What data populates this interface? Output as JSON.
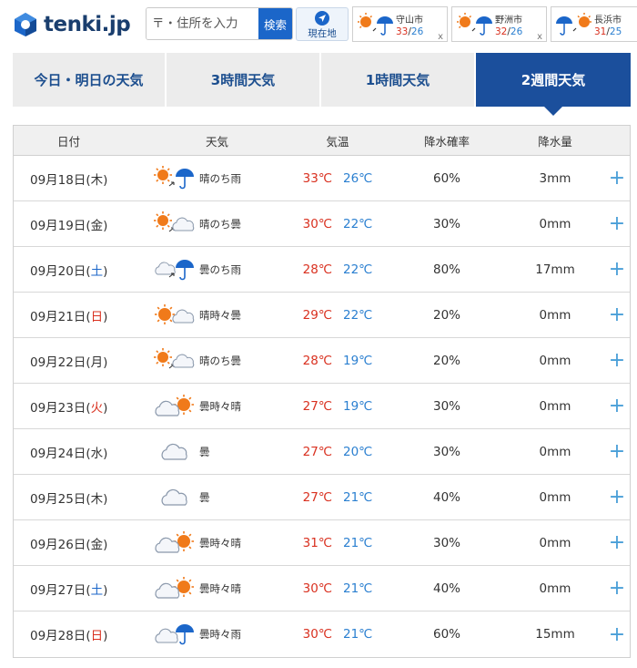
{
  "header": {
    "logo_text": "tenki.jp",
    "search": {
      "placeholder": "〒・住所を入力",
      "button_label": "検索"
    },
    "current_location_label": "現在地",
    "favorites": [
      {
        "city": "守山市",
        "high": "33",
        "low": "26",
        "icon": "sun-then-rain-icon",
        "close": "x"
      },
      {
        "city": "野洲市",
        "high": "32",
        "low": "26",
        "icon": "sun-then-rain-icon",
        "close": "x"
      },
      {
        "city": "長浜市",
        "high": "31",
        "low": "25",
        "icon": "rain-then-sun-icon",
        "close": ""
      }
    ]
  },
  "tabs": [
    {
      "label": "今日・明日の天気",
      "active": false
    },
    {
      "label": "3時間天気",
      "active": false
    },
    {
      "label": "1時間天気",
      "active": false
    },
    {
      "label": "2週間天気",
      "active": true
    }
  ],
  "table": {
    "headers": {
      "date": "日付",
      "weather": "天気",
      "temp": "気温",
      "prob": "降水確率",
      "amount": "降水量"
    },
    "rows": [
      {
        "date": "09月18日(",
        "dow": "木",
        "dow_type": "weekday",
        "close": ")",
        "icon": "sun-then-rain-icon",
        "weather": "晴のち雨",
        "high": "33℃",
        "low": "26℃",
        "prob": "60%",
        "amount": "3mm",
        "expand": "+"
      },
      {
        "date": "09月19日(",
        "dow": "金",
        "dow_type": "weekday",
        "close": ")",
        "icon": "sun-then-cloud-icon",
        "weather": "晴のち曇",
        "high": "30℃",
        "low": "22℃",
        "prob": "30%",
        "amount": "0mm",
        "expand": "+"
      },
      {
        "date": "09月20日(",
        "dow": "土",
        "dow_type": "sat",
        "close": ")",
        "icon": "cloud-then-rain-icon",
        "weather": "曇のち雨",
        "high": "28℃",
        "low": "22℃",
        "prob": "80%",
        "amount": "17mm",
        "expand": "+"
      },
      {
        "date": "09月21日(",
        "dow": "日",
        "dow_type": "sun",
        "close": ")",
        "icon": "sun-sometimes-cloud-icon",
        "weather": "晴時々曇",
        "high": "29℃",
        "low": "22℃",
        "prob": "20%",
        "amount": "0mm",
        "expand": "+"
      },
      {
        "date": "09月22日(",
        "dow": "月",
        "dow_type": "weekday",
        "close": ")",
        "icon": "sun-then-cloud-icon",
        "weather": "晴のち曇",
        "high": "28℃",
        "low": "19℃",
        "prob": "20%",
        "amount": "0mm",
        "expand": "+"
      },
      {
        "date": "09月23日(",
        "dow": "火",
        "dow_type": "sun",
        "close": ")",
        "icon": "cloud-sometimes-sun-icon",
        "weather": "曇時々晴",
        "high": "27℃",
        "low": "19℃",
        "prob": "30%",
        "amount": "0mm",
        "expand": "+"
      },
      {
        "date": "09月24日(",
        "dow": "水",
        "dow_type": "weekday",
        "close": ")",
        "icon": "cloud-icon",
        "weather": "曇",
        "high": "27℃",
        "low": "20℃",
        "prob": "30%",
        "amount": "0mm",
        "expand": "+"
      },
      {
        "date": "09月25日(",
        "dow": "木",
        "dow_type": "weekday",
        "close": ")",
        "icon": "cloud-icon",
        "weather": "曇",
        "high": "27℃",
        "low": "21℃",
        "prob": "40%",
        "amount": "0mm",
        "expand": "+"
      },
      {
        "date": "09月26日(",
        "dow": "金",
        "dow_type": "weekday",
        "close": ")",
        "icon": "cloud-sometimes-sun-icon",
        "weather": "曇時々晴",
        "high": "31℃",
        "low": "21℃",
        "prob": "30%",
        "amount": "0mm",
        "expand": "+"
      },
      {
        "date": "09月27日(",
        "dow": "土",
        "dow_type": "sat",
        "close": ")",
        "icon": "cloud-sometimes-sun-icon",
        "weather": "曇時々晴",
        "high": "30℃",
        "low": "21℃",
        "prob": "40%",
        "amount": "0mm",
        "expand": "+"
      },
      {
        "date": "09月28日(",
        "dow": "日",
        "dow_type": "sun",
        "close": ")",
        "icon": "cloud-sometimes-rain-icon",
        "weather": "曇時々雨",
        "high": "30℃",
        "low": "21℃",
        "prob": "60%",
        "amount": "15mm",
        "expand": "+"
      }
    ]
  },
  "colors": {
    "brand": "#1b4f9c",
    "high_temp": "#d9301f",
    "low_temp": "#2a7fd0",
    "plus": "#4a9fd8"
  }
}
